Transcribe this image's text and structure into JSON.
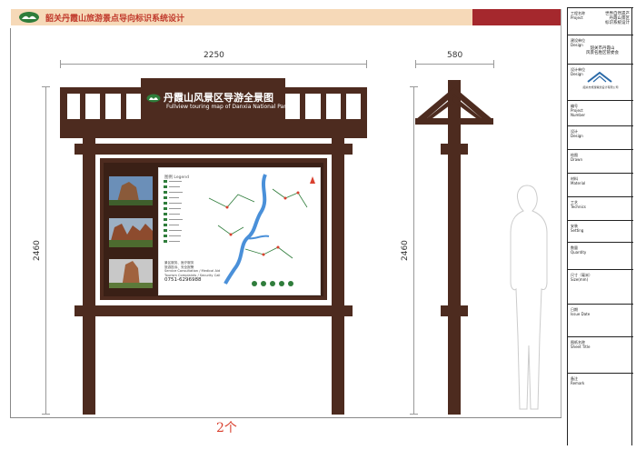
{
  "header": {
    "title": "韶关丹霞山旅游景点导向标识系统设计",
    "accent_color": "#a5282d",
    "bar_color": "#f6d9b8"
  },
  "title_block": {
    "project_label": "工程名称\nProject",
    "project_value": "世界自然遗产\n丹霞山景区\n标识系统设计",
    "client_label": "建设单位\nDesign",
    "client_value": "韶关市丹霞山\n风景名胜区管委会",
    "design_label": "设计单位\nDesign",
    "design_org": "韶关市旅游策划设计有限公司",
    "number_label": "编号\nProject\nNumber",
    "design2_label": "设计\nDesign",
    "drawn_label": "绘图\nDrawn",
    "material_label": "材料\nMaterial",
    "technics_label": "工艺\nTechnics",
    "setting_label": "安装\nSetting",
    "quantity_label": "数量\nQuantity",
    "size_label": "尺寸（毫米）\nSize(mm)",
    "date_label": "日期\nIssue Date",
    "sheet_label": "图纸名称\nSheet Title",
    "remark_label": "备注\nRemark"
  },
  "dimensions": {
    "front_width": "2250",
    "side_width": "580",
    "front_height": "2460",
    "side_height": "2460"
  },
  "sign": {
    "title_cn": "丹霞山风景区导游全景图",
    "title_en": "Fullview touring map of Danxia National Park",
    "legend_title": "图例 Legend",
    "contact_lines": "景区服务、医疗服务\n旅游投诉、安全报警\nService Consultation / Medical Aid\nTourism Complaints / Security Call",
    "phone": "0751-6296988",
    "wood_color": "#4d2b1f"
  },
  "quantity_note": "2个"
}
